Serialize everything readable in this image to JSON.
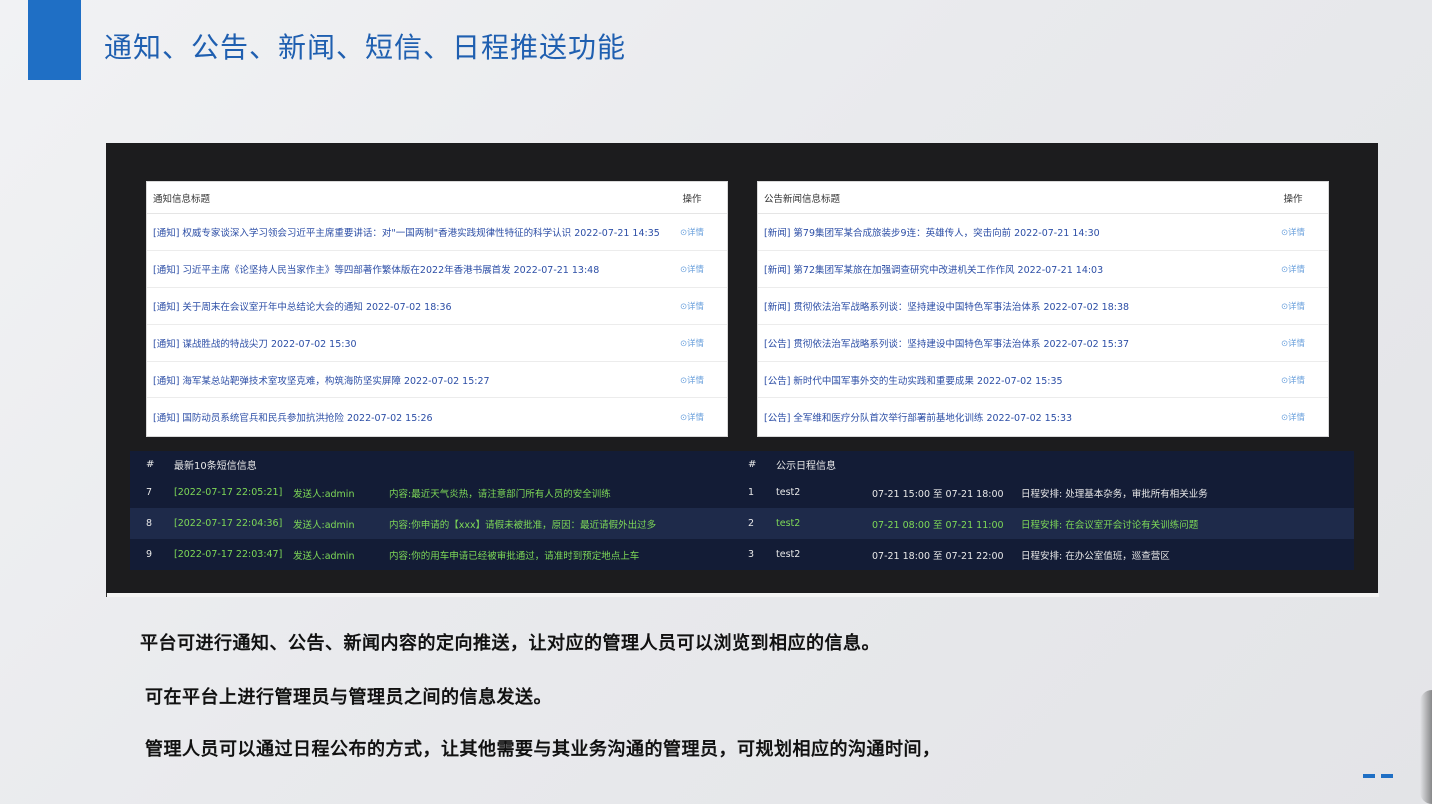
{
  "slide": {
    "title": "通知、公告、新闻、短信、日程推送功能",
    "captions": [
      "平台可进行通知、公告、新闻内容的定向推送，让对应的管理人员可以浏览到相应的信息。",
      "可在平台上进行管理员与管理员之间的信息发送。",
      "管理人员可以通过日程公布的方式，让其他需要与其业务沟通的管理员，可规划相应的沟通时间，"
    ]
  },
  "notice_panel": {
    "header_title": "通知信息标题",
    "header_action": "操作",
    "detail_label": "⊙详情",
    "rows": [
      "[通知] 权威专家谈深入学习领会习近平主席重要讲话：对\"一国两制\"香港实践规律性特征的科学认识 2022-07-21 14:35",
      "[通知] 习近平主席《论坚持人民当家作主》等四部著作繁体版在2022年香港书展首发 2022-07-21 13:48",
      "[通知] 关于周末在会议室开年中总结论大会的通知 2022-07-02 18:36",
      "[通知] 谋战胜战的特战尖刀 2022-07-02 15:30",
      "[通知] 海军某总站靶弹技术室攻坚克难，构筑海防坚实屏障 2022-07-02 15:27",
      "[通知] 国防动员系统官兵和民兵参加抗洪抢险 2022-07-02 15:26"
    ]
  },
  "news_panel": {
    "header_title": "公告新闻信息标题",
    "header_action": "操作",
    "detail_label": "⊙详情",
    "rows": [
      "[新闻] 第79集团军某合成旅装步9连：英雄传人，突击向前 2022-07-21 14:30",
      "[新闻] 第72集团军某旅在加强调查研究中改进机关工作作风 2022-07-21 14:03",
      "[新闻] 贯彻依法治军战略系列谈：坚持建设中国特色军事法治体系 2022-07-02 18:38",
      "[公告] 贯彻依法治军战略系列谈：坚持建设中国特色军事法治体系 2022-07-02 15:37",
      "[公告] 新时代中国军事外交的生动实践和重要成果 2022-07-02 15:35",
      "[公告] 全军维和医疗分队首次举行部署前基地化训练 2022-07-02 15:33"
    ]
  },
  "sms": {
    "hash": "#",
    "header": "最新10条短信信息",
    "rows": [
      {
        "idx": "7",
        "time": "[2022-07-17 22:05:21]",
        "sender": "发送人:admin",
        "content": "内容:最近天气炎热，请注意部门所有人员的安全训练"
      },
      {
        "idx": "8",
        "time": "[2022-07-17 22:04:36]",
        "sender": "发送人:admin",
        "content": "内容:你申请的【xxx】请假未被批准，原因：最近请假外出过多"
      },
      {
        "idx": "9",
        "time": "[2022-07-17 22:03:47]",
        "sender": "发送人:admin",
        "content": "内容:你的用车申请已经被审批通过，请准时到预定地点上车"
      }
    ]
  },
  "schedule": {
    "hash": "#",
    "header": "公示日程信息",
    "rows": [
      {
        "idx": "1",
        "user": "test2",
        "time": "07-21 15:00 至 07-21 18:00",
        "plan": "日程安排: 处理基本杂务，审批所有相关业务"
      },
      {
        "idx": "2",
        "user": "test2",
        "time": "07-21 08:00 至 07-21 11:00",
        "plan": "日程安排: 在会议室开会讨论有关训练问题"
      },
      {
        "idx": "3",
        "user": "test2",
        "time": "07-21 18:00 至 07-21 22:00",
        "plan": "日程安排: 在办公室值班，巡查营区"
      }
    ]
  },
  "colors": {
    "accent": "#1f6fc5",
    "title": "#1f5fb0",
    "link": "#2c4ea6",
    "sms_green": "#7ed957",
    "dark_panel": "#131c36"
  }
}
